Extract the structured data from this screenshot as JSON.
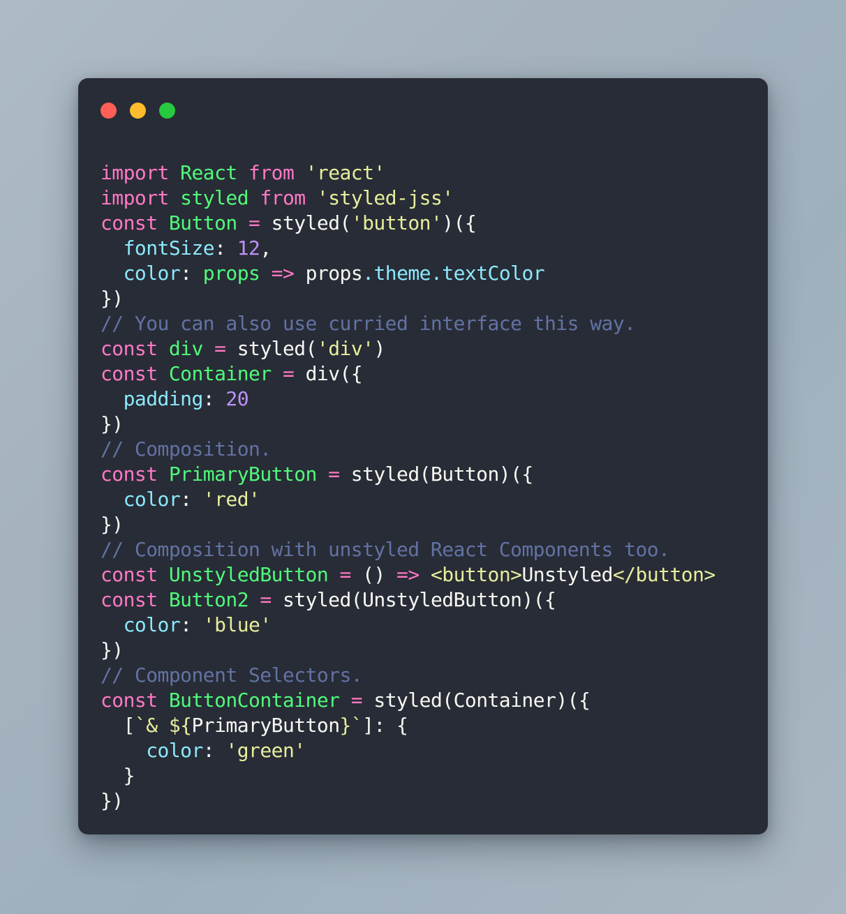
{
  "window": {
    "background_color": "#282c36",
    "page_background_color": "#a8b5c0",
    "traffic_lights": [
      {
        "name": "close",
        "color": "#ff5f56"
      },
      {
        "name": "minimize",
        "color": "#ffbd2e"
      },
      {
        "name": "zoom",
        "color": "#27c93f"
      }
    ]
  },
  "palette": {
    "keyword": "#ff79c6",
    "identifier": "#50fa7b",
    "string": "#e6ee9c",
    "property": "#8be9fd",
    "number": "#bd93f9",
    "plain": "#f8f8f2",
    "comment": "#6272a4"
  },
  "code": {
    "language": "jsx",
    "plain_text": "import React from 'react'\nimport styled from 'styled-jss'\nconst Button = styled('button')({\n  fontSize: 12,\n  color: props => props.theme.textColor\n})\n// You can also use curried interface this way.\nconst div = styled('div')\nconst Container = div({\n  padding: 20\n})\n// Composition.\nconst PrimaryButton = styled(Button)({\n  color: 'red'\n})\n// Composition with unstyled React Components too.\nconst UnstyledButton = () => <button>Unstyled</button>\nconst Button2 = styled(UnstyledButton)({\n  color: 'blue'\n})\n// Component Selectors.\nconst ButtonContainer = styled(Container)({\n  [`& ${PrimaryButton}`]: {\n    color: 'green'\n  }\n})",
    "lines": [
      {
        "n": 1,
        "tokens": [
          {
            "t": "import",
            "c": "kw"
          },
          {
            "t": " ",
            "c": "plain"
          },
          {
            "t": "React",
            "c": "ident"
          },
          {
            "t": " ",
            "c": "plain"
          },
          {
            "t": "from",
            "c": "kw"
          },
          {
            "t": " ",
            "c": "plain"
          },
          {
            "t": "'react'",
            "c": "str"
          }
        ]
      },
      {
        "n": 2,
        "tokens": [
          {
            "t": "import",
            "c": "kw"
          },
          {
            "t": " ",
            "c": "plain"
          },
          {
            "t": "styled",
            "c": "ident"
          },
          {
            "t": " ",
            "c": "plain"
          },
          {
            "t": "from",
            "c": "kw"
          },
          {
            "t": " ",
            "c": "plain"
          },
          {
            "t": "'styled-jss'",
            "c": "str"
          }
        ]
      },
      {
        "n": 3,
        "tokens": [
          {
            "t": "const",
            "c": "kw"
          },
          {
            "t": " ",
            "c": "plain"
          },
          {
            "t": "Button",
            "c": "ident"
          },
          {
            "t": " ",
            "c": "plain"
          },
          {
            "t": "=",
            "c": "op"
          },
          {
            "t": " ",
            "c": "plain"
          },
          {
            "t": "styled(",
            "c": "plain"
          },
          {
            "t": "'button'",
            "c": "str"
          },
          {
            "t": ")({",
            "c": "plain"
          }
        ]
      },
      {
        "n": 4,
        "tokens": [
          {
            "t": "  ",
            "c": "plain"
          },
          {
            "t": "fontSize",
            "c": "prop"
          },
          {
            "t": ": ",
            "c": "plain"
          },
          {
            "t": "12",
            "c": "num"
          },
          {
            "t": ",",
            "c": "plain"
          }
        ]
      },
      {
        "n": 5,
        "tokens": [
          {
            "t": "  ",
            "c": "plain"
          },
          {
            "t": "color",
            "c": "prop"
          },
          {
            "t": ": ",
            "c": "plain"
          },
          {
            "t": "props",
            "c": "ident"
          },
          {
            "t": " ",
            "c": "plain"
          },
          {
            "t": "=>",
            "c": "op"
          },
          {
            "t": " ",
            "c": "plain"
          },
          {
            "t": "props",
            "c": "plain"
          },
          {
            "t": ".theme",
            "c": "prop"
          },
          {
            "t": ".textColor",
            "c": "prop"
          }
        ]
      },
      {
        "n": 6,
        "tokens": [
          {
            "t": "})",
            "c": "plain"
          }
        ]
      },
      {
        "n": 7,
        "tokens": [
          {
            "t": "// You can also use curried interface this way.",
            "c": "comment"
          }
        ]
      },
      {
        "n": 8,
        "tokens": [
          {
            "t": "const",
            "c": "kw"
          },
          {
            "t": " ",
            "c": "plain"
          },
          {
            "t": "div",
            "c": "ident"
          },
          {
            "t": " ",
            "c": "plain"
          },
          {
            "t": "=",
            "c": "op"
          },
          {
            "t": " ",
            "c": "plain"
          },
          {
            "t": "styled(",
            "c": "plain"
          },
          {
            "t": "'div'",
            "c": "str"
          },
          {
            "t": ")",
            "c": "plain"
          }
        ]
      },
      {
        "n": 9,
        "tokens": [
          {
            "t": "const",
            "c": "kw"
          },
          {
            "t": " ",
            "c": "plain"
          },
          {
            "t": "Container",
            "c": "ident"
          },
          {
            "t": " ",
            "c": "plain"
          },
          {
            "t": "=",
            "c": "op"
          },
          {
            "t": " ",
            "c": "plain"
          },
          {
            "t": "div({",
            "c": "plain"
          }
        ]
      },
      {
        "n": 10,
        "tokens": [
          {
            "t": "  ",
            "c": "plain"
          },
          {
            "t": "padding",
            "c": "prop"
          },
          {
            "t": ": ",
            "c": "plain"
          },
          {
            "t": "20",
            "c": "num"
          }
        ]
      },
      {
        "n": 11,
        "tokens": [
          {
            "t": "})",
            "c": "plain"
          }
        ]
      },
      {
        "n": 12,
        "tokens": [
          {
            "t": "// Composition.",
            "c": "comment"
          }
        ]
      },
      {
        "n": 13,
        "tokens": [
          {
            "t": "const",
            "c": "kw"
          },
          {
            "t": " ",
            "c": "plain"
          },
          {
            "t": "PrimaryButton",
            "c": "ident"
          },
          {
            "t": " ",
            "c": "plain"
          },
          {
            "t": "=",
            "c": "op"
          },
          {
            "t": " ",
            "c": "plain"
          },
          {
            "t": "styled(Button)({",
            "c": "plain"
          }
        ]
      },
      {
        "n": 14,
        "tokens": [
          {
            "t": "  ",
            "c": "plain"
          },
          {
            "t": "color",
            "c": "prop"
          },
          {
            "t": ": ",
            "c": "plain"
          },
          {
            "t": "'red'",
            "c": "str"
          }
        ]
      },
      {
        "n": 15,
        "tokens": [
          {
            "t": "})",
            "c": "plain"
          }
        ]
      },
      {
        "n": 16,
        "tokens": [
          {
            "t": "// Composition with unstyled React Components too.",
            "c": "comment"
          }
        ]
      },
      {
        "n": 17,
        "tokens": [
          {
            "t": "const",
            "c": "kw"
          },
          {
            "t": " ",
            "c": "plain"
          },
          {
            "t": "UnstyledButton",
            "c": "ident"
          },
          {
            "t": " ",
            "c": "plain"
          },
          {
            "t": "=",
            "c": "op"
          },
          {
            "t": " ",
            "c": "plain"
          },
          {
            "t": "()",
            "c": "plain"
          },
          {
            "t": " ",
            "c": "plain"
          },
          {
            "t": "=>",
            "c": "op"
          },
          {
            "t": " ",
            "c": "plain"
          },
          {
            "t": "<button>",
            "c": "str"
          },
          {
            "t": "Unstyled",
            "c": "plain"
          },
          {
            "t": "</button>",
            "c": "str"
          }
        ]
      },
      {
        "n": 18,
        "tokens": [
          {
            "t": "const",
            "c": "kw"
          },
          {
            "t": " ",
            "c": "plain"
          },
          {
            "t": "Button2",
            "c": "ident"
          },
          {
            "t": " ",
            "c": "plain"
          },
          {
            "t": "=",
            "c": "op"
          },
          {
            "t": " ",
            "c": "plain"
          },
          {
            "t": "styled(UnstyledButton)({",
            "c": "plain"
          }
        ]
      },
      {
        "n": 19,
        "tokens": [
          {
            "t": "  ",
            "c": "plain"
          },
          {
            "t": "color",
            "c": "prop"
          },
          {
            "t": ": ",
            "c": "plain"
          },
          {
            "t": "'blue'",
            "c": "str"
          }
        ]
      },
      {
        "n": 20,
        "tokens": [
          {
            "t": "})",
            "c": "plain"
          }
        ]
      },
      {
        "n": 21,
        "tokens": [
          {
            "t": "// Component Selectors.",
            "c": "comment"
          }
        ]
      },
      {
        "n": 22,
        "tokens": [
          {
            "t": "const",
            "c": "kw"
          },
          {
            "t": " ",
            "c": "plain"
          },
          {
            "t": "ButtonContainer",
            "c": "ident"
          },
          {
            "t": " ",
            "c": "plain"
          },
          {
            "t": "=",
            "c": "op"
          },
          {
            "t": " ",
            "c": "plain"
          },
          {
            "t": "styled(Container)({",
            "c": "plain"
          }
        ]
      },
      {
        "n": 23,
        "tokens": [
          {
            "t": "  ",
            "c": "plain"
          },
          {
            "t": "[",
            "c": "plain"
          },
          {
            "t": "`& ",
            "c": "str"
          },
          {
            "t": "${",
            "c": "str"
          },
          {
            "t": "PrimaryButton",
            "c": "plain"
          },
          {
            "t": "}",
            "c": "str"
          },
          {
            "t": "`",
            "c": "str"
          },
          {
            "t": "]: {",
            "c": "plain"
          }
        ]
      },
      {
        "n": 24,
        "tokens": [
          {
            "t": "    ",
            "c": "plain"
          },
          {
            "t": "color",
            "c": "prop"
          },
          {
            "t": ": ",
            "c": "plain"
          },
          {
            "t": "'green'",
            "c": "str"
          }
        ]
      },
      {
        "n": 25,
        "tokens": [
          {
            "t": "  }",
            "c": "plain"
          }
        ]
      },
      {
        "n": 26,
        "tokens": [
          {
            "t": "})",
            "c": "plain"
          }
        ]
      }
    ]
  }
}
